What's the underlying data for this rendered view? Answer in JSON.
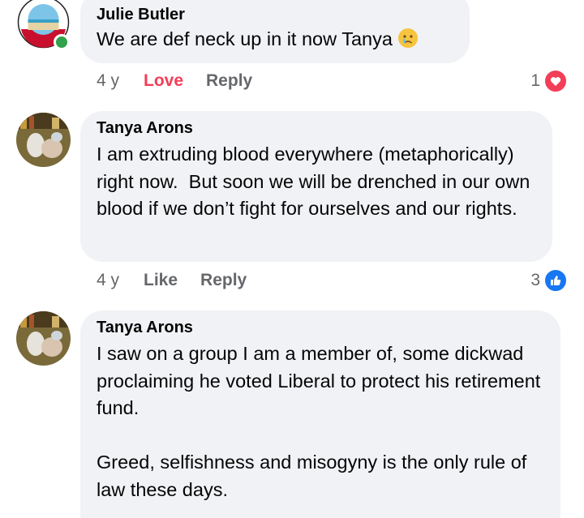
{
  "comments": [
    {
      "author": "Julie Butler",
      "text": "We are def neck up in it now Tanya",
      "emoji": "crying-face-emoji",
      "time": "4 y",
      "action_1": "Love",
      "action_2": "Reply",
      "reaction_count": "1",
      "reaction_icon": "heart-icon",
      "reaction_color": "#f33e58",
      "online": true
    },
    {
      "author": "Tanya Arons",
      "text": "I am extruding blood everywhere (metaphorically) right now.  But soon we will be drenched in our own blood if we don’t fight for ourselves and our rights.",
      "time": "4 y",
      "action_1": "Like",
      "action_2": "Reply",
      "reaction_count": "3",
      "reaction_icon": "thumbs-up-icon",
      "reaction_color": "#1877f2"
    },
    {
      "author": "Tanya Arons",
      "text": "I saw on a group I am a member of, some dickwad proclaiming he voted Liberal to protect his retirement fund.\n\nGreed, selfishness and misogyny is the only rule of law these days."
    }
  ]
}
